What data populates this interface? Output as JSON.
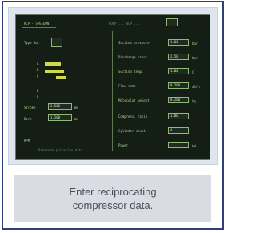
{
  "caption": "Enter reciprocating\ncompressor data.",
  "screen": {
    "title": "RCP - SPEEDON",
    "header_right": "PUMP  ...  RCP  ...",
    "left_labels": [
      "Type No.",
      "A",
      "B",
      "C",
      "D",
      "E",
      "Stroke",
      "Bore",
      "RPM"
    ],
    "right_labels": [
      "Suction pressure",
      "Discharge press.",
      "Suction temp.",
      "Flow rate",
      "Molecular weight",
      "Compress. ratio",
      "Cylinder count",
      "Power"
    ],
    "right_values": [
      "1.00",
      "2.50",
      "1.00",
      "0.200",
      "0.200",
      "1.00",
      "4"
    ],
    "right_units": [
      "bar",
      "bar",
      "C",
      "m3/h",
      "kg",
      "",
      "kW"
    ],
    "left_values": [
      "2.500",
      "1.500"
    ],
    "left_units": [
      "mm",
      "mm"
    ],
    "footer_left": "Pressure pulsation data  ...",
    "footer_right": "Run analysis"
  }
}
